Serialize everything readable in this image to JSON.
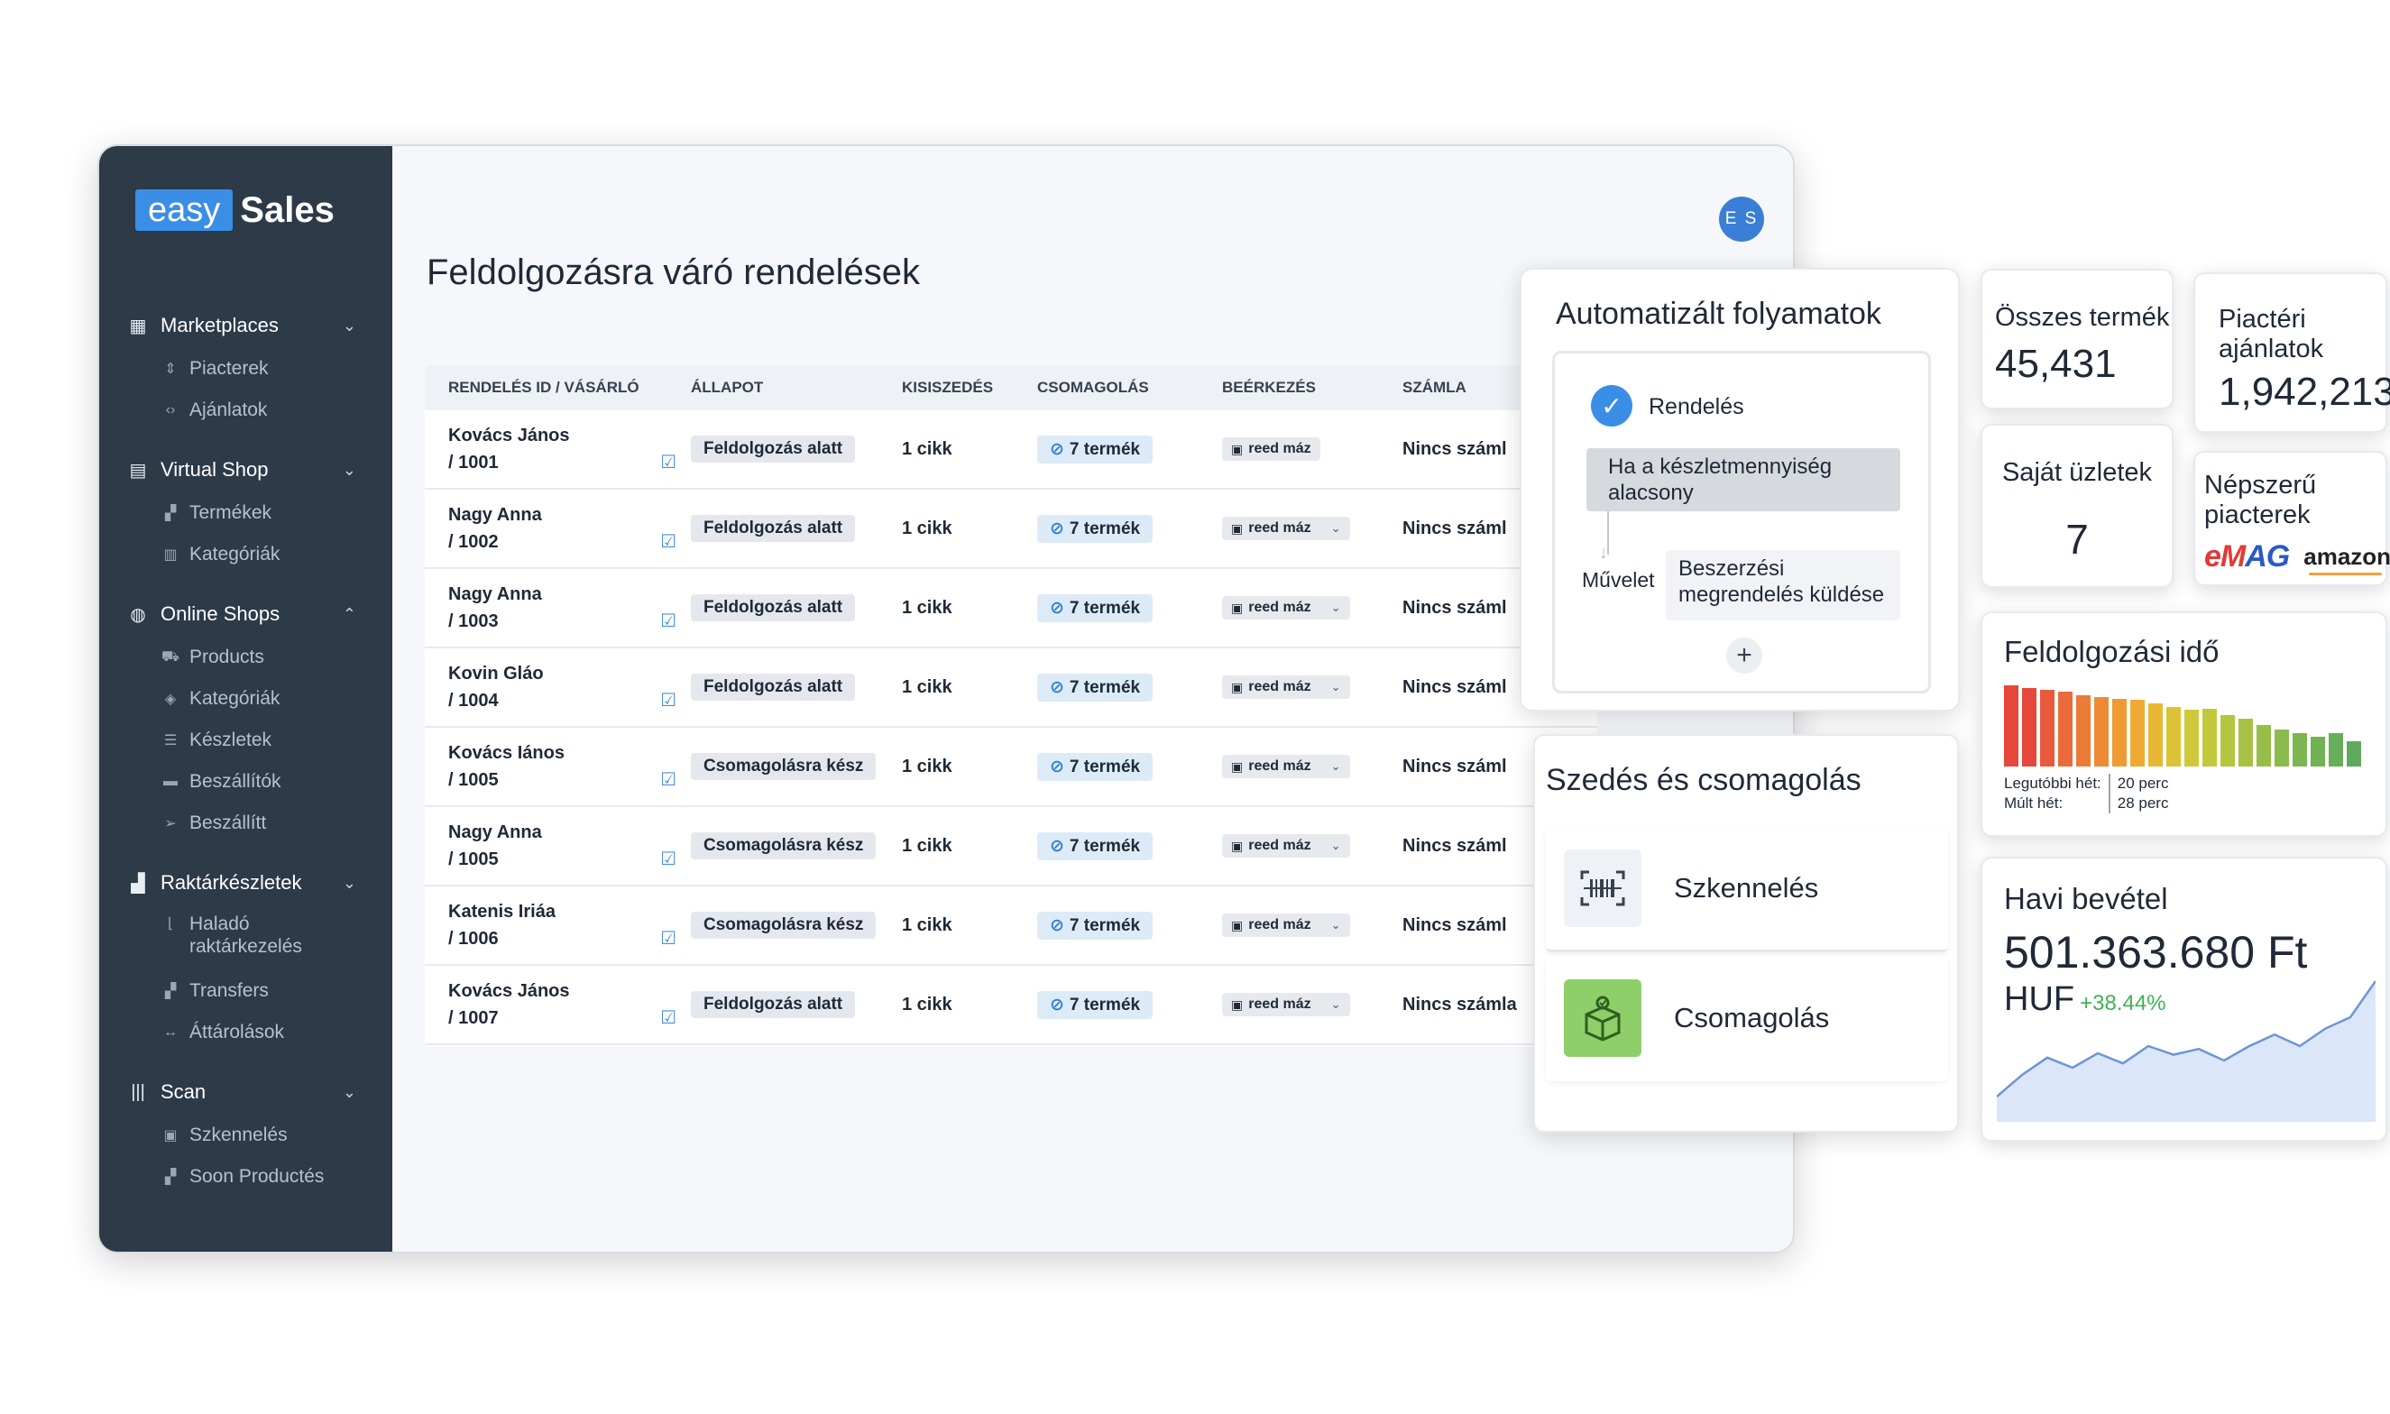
{
  "brand": {
    "easy": "easy",
    "sales": "Sales"
  },
  "user": {
    "initials": "E S"
  },
  "sidebar": {
    "groups": [
      {
        "label": "Marketplaces",
        "icon": "marketplace-icon",
        "expanded": false,
        "items": [
          {
            "label": "Piacterek",
            "icon": "sort-icon"
          },
          {
            "label": "Ajánlatok",
            "icon": "code-icon"
          }
        ]
      },
      {
        "label": "Virtual Shop",
        "icon": "shop-icon",
        "expanded": false,
        "items": [
          {
            "label": "Termékek",
            "icon": "boxes-icon"
          },
          {
            "label": "Kategóriák",
            "icon": "grid-icon"
          }
        ]
      },
      {
        "label": "Online Shops",
        "icon": "globe-icon",
        "expanded": true,
        "items": [
          {
            "label": "Products",
            "icon": "cart-icon"
          },
          {
            "label": "Kategóriák",
            "icon": "tag-icon"
          },
          {
            "label": "Készletek",
            "icon": "list-icon"
          },
          {
            "label": "Beszállítók",
            "icon": "folder-icon"
          },
          {
            "label": "Beszállítt",
            "icon": "send-icon"
          }
        ]
      },
      {
        "label": "Raktárkészletek",
        "icon": "warehouse-icon",
        "expanded": false,
        "items": [
          {
            "label": "Haladó raktárkezelés",
            "icon": "chart-icon"
          },
          {
            "label": "Transfers",
            "icon": "transfer-icon"
          },
          {
            "label": "Áttárolások",
            "icon": "move-icon"
          }
        ]
      },
      {
        "label": "Scan",
        "icon": "barcode-icon",
        "expanded": false,
        "items": [
          {
            "label": "Szkennelés",
            "icon": "scan-icon"
          },
          {
            "label": "Soon Productés",
            "icon": "boxes-icon"
          }
        ]
      }
    ]
  },
  "main": {
    "title": "Feldolgozásra váró rendelések",
    "columns": [
      "RENDELÉS ID / VÁSÁRLÓ",
      "ÁLLAPOT",
      "KISISZEDÉS",
      "CSOMAGOLÁS",
      "BEÉRKEZÉS",
      "SZÁMLA"
    ],
    "rows": [
      {
        "buyer": "Kovács János",
        "id": "/ 1001",
        "status": "Feldolgozás alatt",
        "pick": "1 cikk",
        "pack": "7 termék",
        "arrival": "reed máz",
        "invoice": "Nincs száml",
        "dropdown": false
      },
      {
        "buyer": "Nagy Anna",
        "id": "/ 1002",
        "status": "Feldolgozás alatt",
        "pick": "1 cikk",
        "pack": "7 termék",
        "arrival": "reed máz",
        "invoice": "Nincs száml",
        "dropdown": true
      },
      {
        "buyer": "Nagy Anna",
        "id": "/ 1003",
        "status": "Feldolgozás alatt",
        "pick": "1 cikk",
        "pack": "7 termék",
        "arrival": "reed máz",
        "invoice": "Nincs száml",
        "dropdown": true
      },
      {
        "buyer": "Kovin Gláo",
        "id": "/ 1004",
        "status": "Feldolgozás alatt",
        "pick": "1 cikk",
        "pack": "7 termék",
        "arrival": "reed máz",
        "invoice": "Nincs száml",
        "dropdown": true
      },
      {
        "buyer": "Kovács Iános",
        "id": "/ 1005",
        "status": "Csomagolásra kész",
        "pick": "1 cikk",
        "pack": "7 termék",
        "arrival": "reed máz",
        "invoice": "Nincs száml",
        "dropdown": true
      },
      {
        "buyer": "Nagy Anna",
        "id": "/ 1005",
        "status": "Csomagolásra kész",
        "pick": "1 cikk",
        "pack": "7 termék",
        "arrival": "reed máz",
        "invoice": "Nincs száml",
        "dropdown": true
      },
      {
        "buyer": "Katenis Iriáa",
        "id": "/ 1006",
        "status": "Csomagolásra kész",
        "pick": "1 cikk",
        "pack": "7 termék",
        "arrival": "reed máz",
        "invoice": "Nincs száml",
        "dropdown": true
      },
      {
        "buyer": "Kovács János",
        "id": "/ 1007",
        "status": "Feldolgozás alatt",
        "pick": "1 cikk",
        "pack": "7 termék",
        "arrival": "reed máz",
        "invoice": "Nincs számla",
        "dropdown": true
      }
    ]
  },
  "automation": {
    "title": "Automatizált folyamatok",
    "trigger": "Rendelés",
    "condition": "Ha a készletmennyiség alacsony",
    "action_label": "Művelet",
    "action": "Beszerzési megrendelés küldése",
    "add": "+"
  },
  "picking": {
    "title": "Szedés és csomagolás",
    "items": [
      {
        "label": "Szkennelés",
        "icon": "barcode-scan-icon"
      },
      {
        "label": "Csomagolás",
        "icon": "package-icon"
      }
    ]
  },
  "stats": {
    "total_products": {
      "label": "Összes termék",
      "value": "45,431"
    },
    "marketplace_offers": {
      "label": "Piactéri ajánlatok",
      "value": "1,942,213"
    },
    "own_shops": {
      "label": "Saját üzletek",
      "value": "7"
    },
    "popular_marketplaces": {
      "label": "Népszerű piacterek",
      "logo1_a": "eM",
      "logo1_b": "AG",
      "logo2": "amazon"
    },
    "processing_time": {
      "label": "Feldolgozási idő",
      "last_week_label": "Legutóbbi hét:",
      "last_week_value": "20 perc",
      "prev_week_label": "Múlt hét:",
      "prev_week_value": "28 perc",
      "bars": [
        0.98,
        0.95,
        0.92,
        0.9,
        0.86,
        0.84,
        0.82,
        0.8,
        0.76,
        0.72,
        0.68,
        0.7,
        0.62,
        0.58,
        0.5,
        0.45,
        0.4,
        0.36,
        0.4,
        0.3
      ],
      "colors": [
        "#e5473a",
        "#e5473a",
        "#e85a3a",
        "#ea6a3a",
        "#ec7a38",
        "#ee8a36",
        "#f09a34",
        "#f0aa34",
        "#e8b834",
        "#dcc234",
        "#cfc838",
        "#c2c83c",
        "#b4c640",
        "#a6c244",
        "#98be48",
        "#8aba4c",
        "#7cb650",
        "#70b254",
        "#66ae58",
        "#5eaa5c"
      ]
    },
    "monthly_revenue": {
      "label": "Havi bevétel",
      "value": "501.363.680 Ft",
      "currency": "HUF",
      "change": "+38.44%",
      "trend": [
        0.15,
        0.3,
        0.42,
        0.35,
        0.45,
        0.38,
        0.5,
        0.44,
        0.48,
        0.4,
        0.5,
        0.58,
        0.5,
        0.62,
        0.7,
        0.95
      ]
    }
  }
}
